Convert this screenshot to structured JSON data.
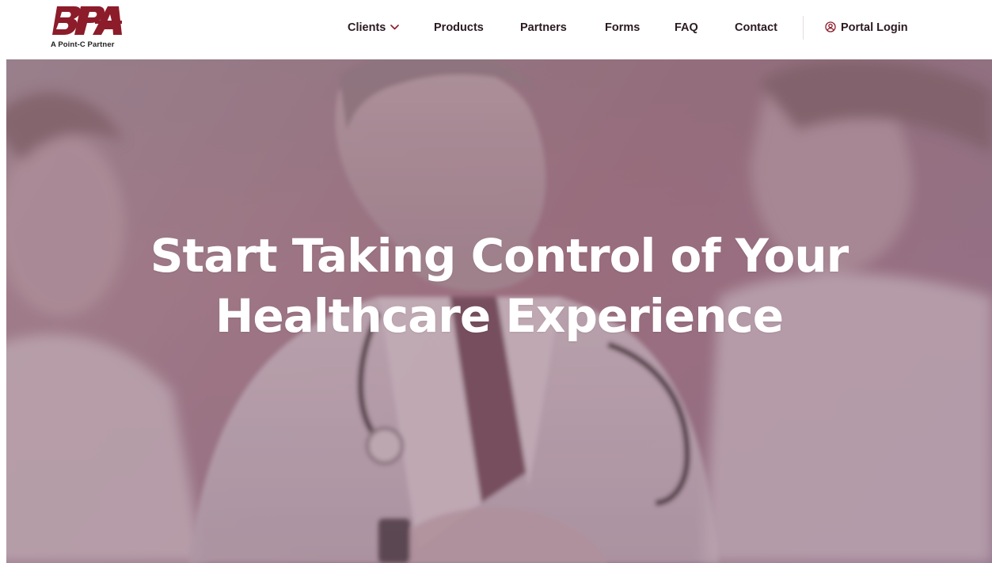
{
  "brand": {
    "logo_text": "BPA",
    "tagline": "A Point-C Partner",
    "color": "#8c1c2a"
  },
  "nav": {
    "items": [
      {
        "label": "Clients",
        "has_dropdown": true
      },
      {
        "label": "Products",
        "has_dropdown": false
      },
      {
        "label": "Partners",
        "has_dropdown": false
      },
      {
        "label": "Forms",
        "has_dropdown": false
      },
      {
        "label": "FAQ",
        "has_dropdown": false
      },
      {
        "label": "Contact",
        "has_dropdown": false
      }
    ],
    "portal_login": {
      "label": "Portal Login",
      "icon": "user-circle-icon"
    },
    "accent_color": "#8c1c2a",
    "text_color": "#2b1a22"
  },
  "hero": {
    "title_line1": "Start Taking Control of Your",
    "title_line2": "Healthcare Experience",
    "overlay_color": "#a87f90"
  }
}
